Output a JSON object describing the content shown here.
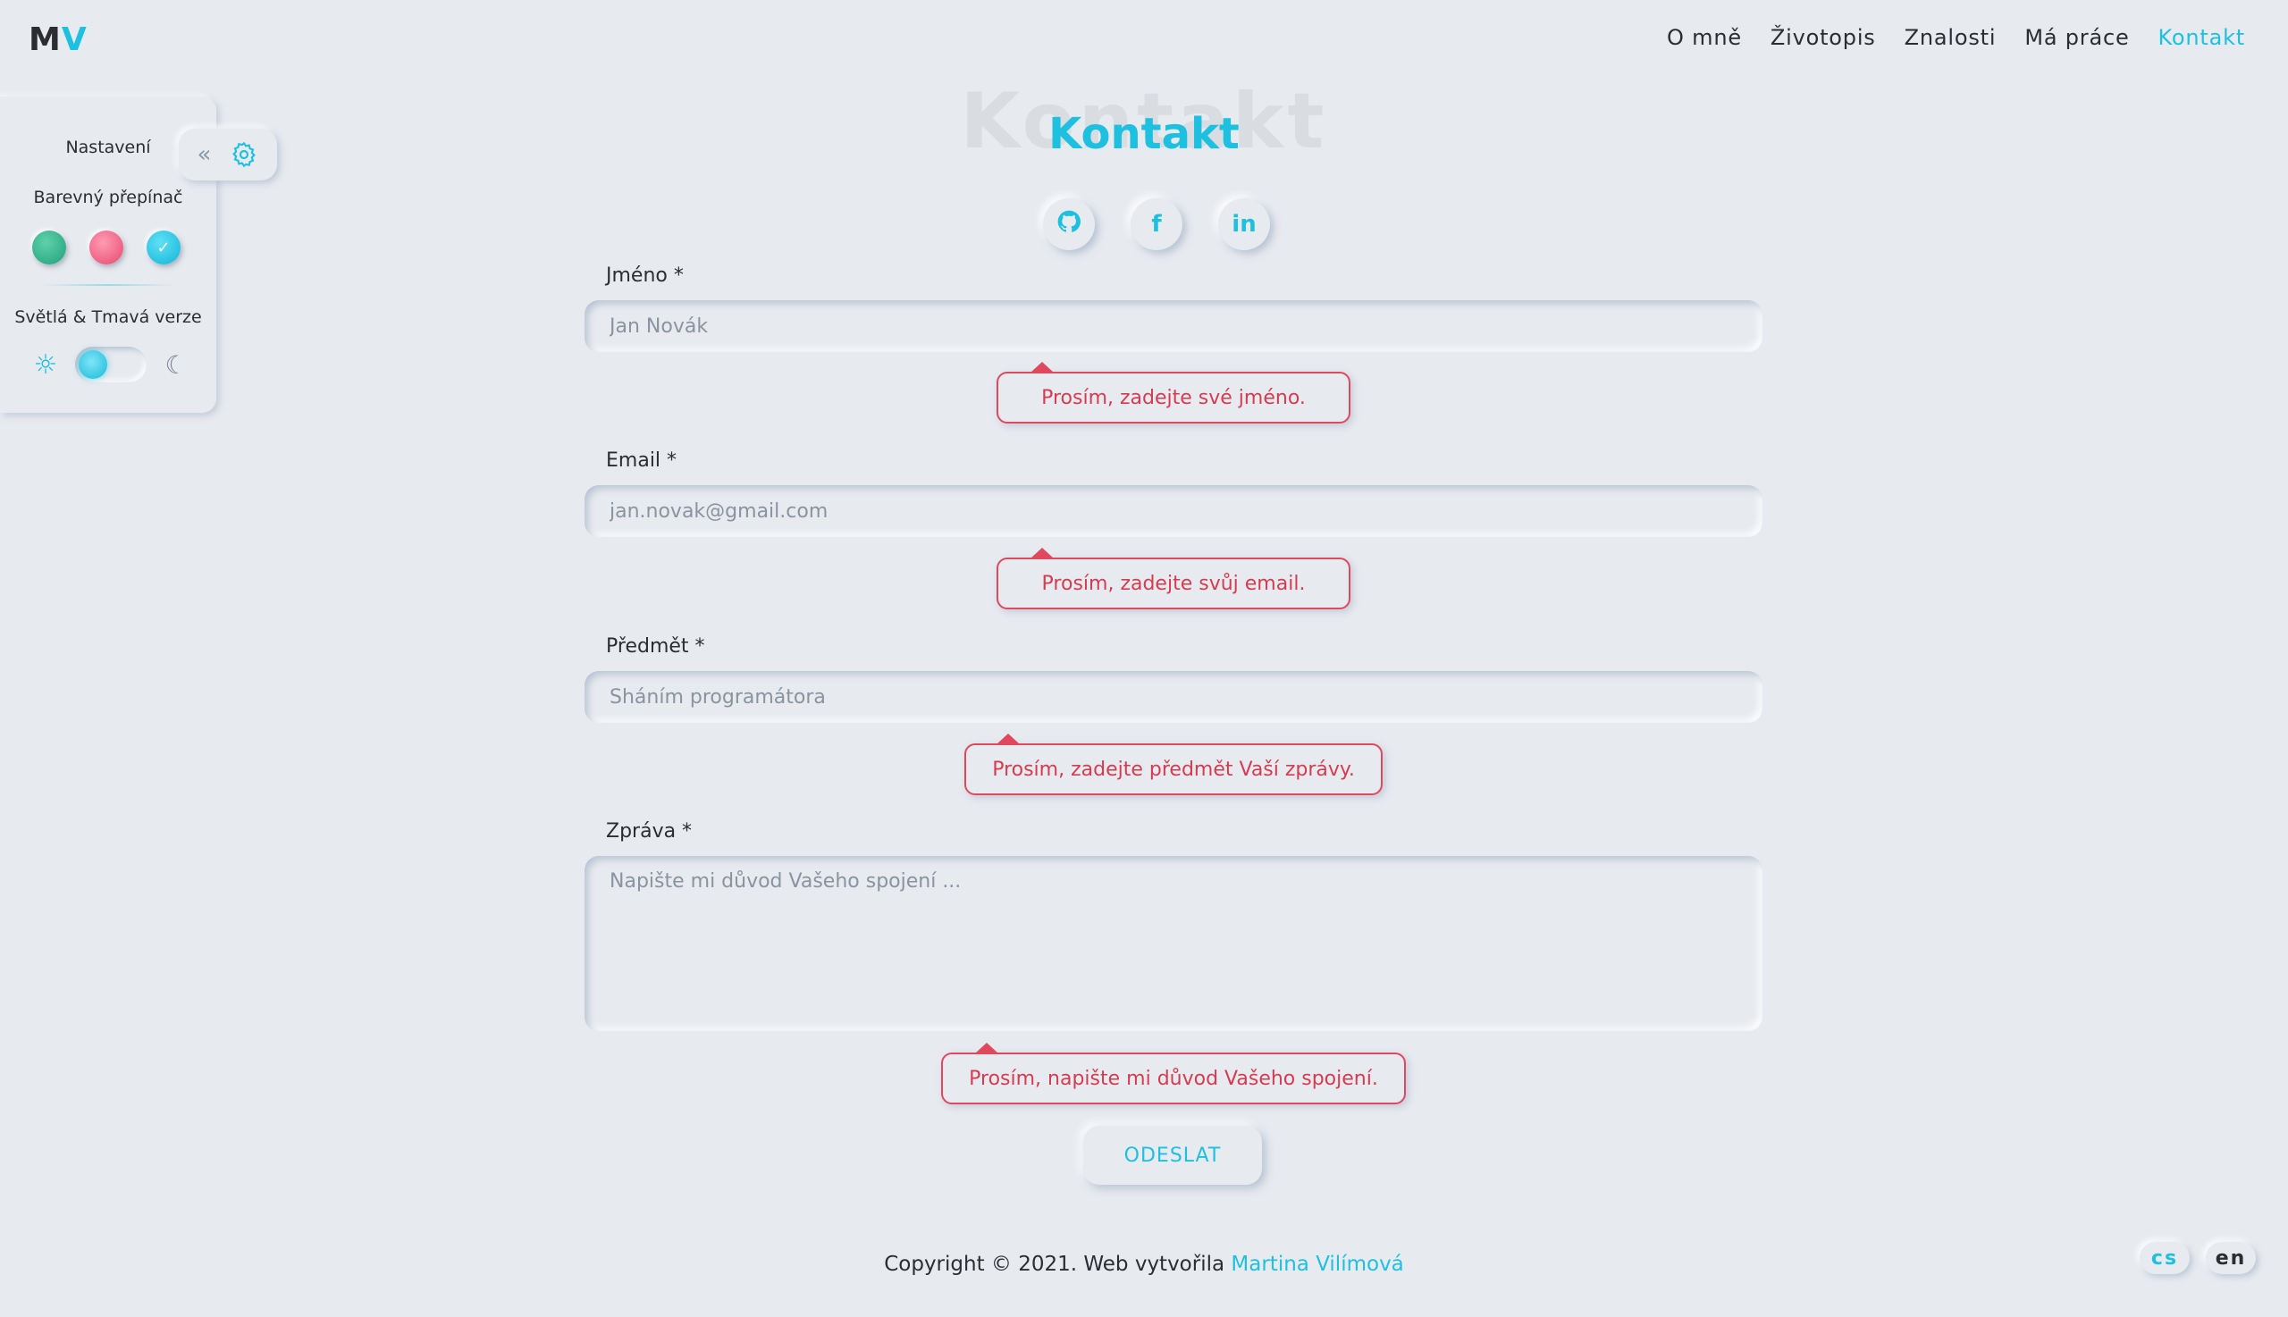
{
  "logo": {
    "m": "M",
    "v": "V"
  },
  "nav": {
    "items": [
      "O mně",
      "Životopis",
      "Znalosti",
      "Má práce",
      "Kontakt"
    ],
    "active": "Kontakt"
  },
  "settings": {
    "title": "Nastavení",
    "color_switch_label": "Barevný přepínač",
    "theme_label": "Světlá & Tmavá verze",
    "colors": [
      "#20a07a",
      "#e8476e",
      "#12b4d8"
    ],
    "selected_color": "#12b4d8",
    "collapse_icon": "chevrons-left-icon",
    "gear_icon": "gear-icon",
    "theme": "light"
  },
  "page": {
    "heading_bg": "Kontakt",
    "heading": "Kontakt",
    "accent": "#1ec0e0"
  },
  "social": {
    "github": "github-icon",
    "facebook": "f",
    "linkedin": "in"
  },
  "form": {
    "name_label": "Jméno *",
    "name_placeholder": "Jan Novák",
    "name_error": "Prosím, zadejte své jméno.",
    "email_label": "Email *",
    "email_placeholder": "jan.novak@gmail.com",
    "email_error": "Prosím, zadejte svůj email.",
    "subject_label": "Předmět *",
    "subject_placeholder": "Sháním programátora",
    "subject_error": "Prosím, zadejte předmět Vaší zprávy.",
    "message_label": "Zpráva *",
    "message_placeholder": "Napište mi důvod Vašeho spojení ...",
    "message_error": "Prosím, napište mi důvod Vašeho spojení.",
    "submit": "ODESLAT",
    "error_color": "#e0485d"
  },
  "footer": {
    "text": "Copyright © 2021. Web vytvořila ",
    "author": "Martina Vilímová"
  },
  "lang": {
    "cs": "cs",
    "en": "en",
    "active": "cs"
  }
}
